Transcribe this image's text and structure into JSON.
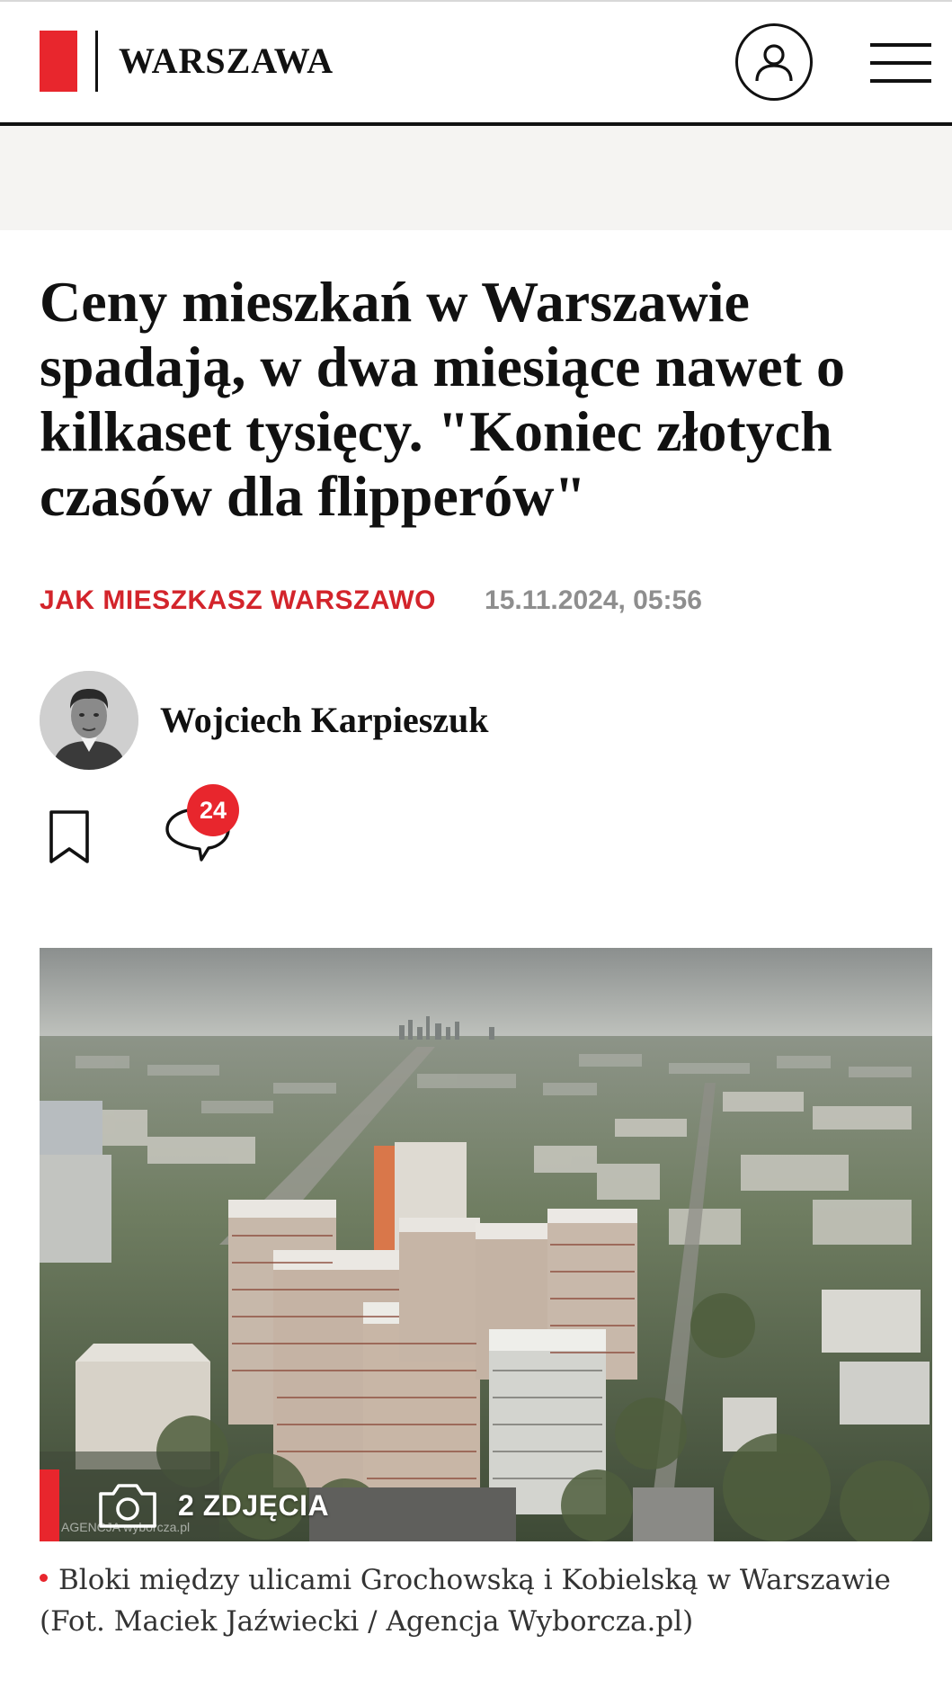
{
  "header": {
    "section_title": "WARSZAWA",
    "brand_color": "#e8262d",
    "user_icon": "user-icon",
    "menu_icon": "hamburger-menu-icon"
  },
  "article": {
    "headline": "Ceny mieszkań w Warszawie spadają, w dwa miesiące nawet o kilkaset tysięcy. \"Koniec złotych czasów dla flipperów\"",
    "category": "JAK MIESZKASZ WARSZAWO",
    "published": "15.11.2024, 05:56",
    "author": {
      "name": "Wojciech Karpieszuk"
    },
    "actions": {
      "bookmark_icon": "bookmark-icon",
      "comments_icon": "comment-bubble-icon",
      "comments_count": "24"
    },
    "photo": {
      "gallery_label": "2 ZDJĘCIA",
      "camera_icon": "camera-icon",
      "watermark": "AGENCJA wyborcza.pl"
    },
    "caption": "Bloki między ulicami Grochowską i Kobielską w Warszawie (Fot. Maciek Jaźwiecki / Agencja Wyborcza.pl)"
  }
}
